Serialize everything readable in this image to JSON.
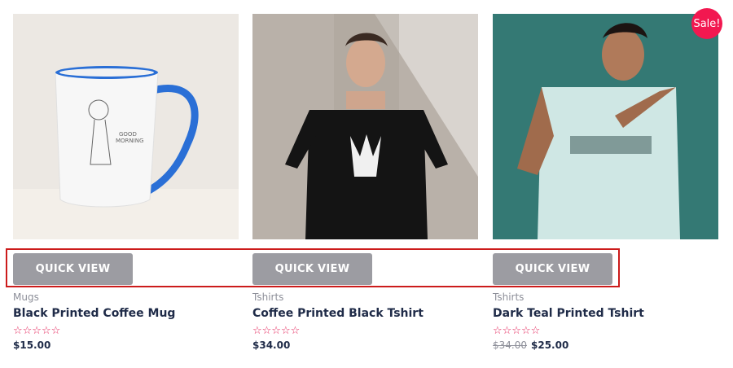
{
  "products": [
    {
      "image_alt": "white mug with blue handle",
      "quick_view_label": "QUICK VIEW",
      "category": "Mugs",
      "title": "Black Printed Coffee Mug",
      "rating_stars": "☆☆☆☆☆",
      "price": "$15.00"
    },
    {
      "image_alt": "man in black skeleton-hand t-shirt",
      "quick_view_label": "QUICK VIEW",
      "category": "Tshirts",
      "title": "Coffee Printed Black Tshirt",
      "rating_stars": "☆☆☆☆☆",
      "price": "$34.00"
    },
    {
      "image_alt": "man in teal printed t-shirt",
      "badge": "Sale!",
      "quick_view_label": "QUICK VIEW",
      "category": "Tshirts",
      "title": "Dark Teal Printed Tshirt",
      "rating_stars": "☆☆☆☆☆",
      "old_price": "$34.00",
      "price": "$25.00"
    }
  ],
  "colors": {
    "button": "#9c9ca2",
    "sale_badge": "#f21850",
    "stars": "#e4245a",
    "title": "#1f2b48",
    "highlight": "#cc1b1b"
  }
}
